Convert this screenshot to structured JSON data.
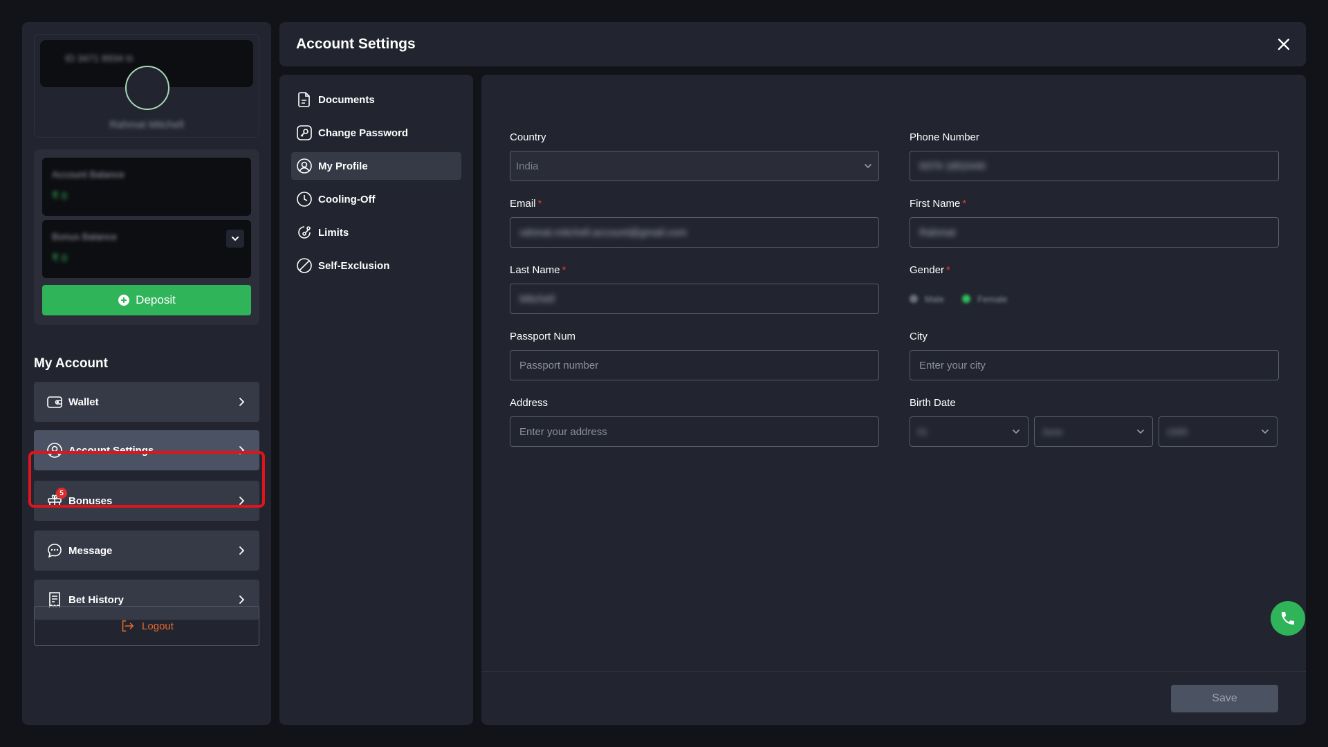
{
  "profile": {
    "user_id": "ID 3471 8934 ⧉",
    "name": "Rahmat Mitchell"
  },
  "balances": {
    "account_label": "Account Balance",
    "account_value": "₹ 0",
    "bonus_label": "Bonus Balance",
    "bonus_value": "₹ 0"
  },
  "deposit_label": "Deposit",
  "sidebar": {
    "heading": "My Account",
    "items": [
      {
        "label": "Wallet"
      },
      {
        "label": "Account Settings"
      },
      {
        "label": "Bonuses",
        "badge": "5"
      },
      {
        "label": "Message"
      },
      {
        "label": "Bet History"
      }
    ],
    "logout_label": "Logout"
  },
  "header": {
    "title": "Account Settings"
  },
  "settings_nav": [
    {
      "label": "Documents"
    },
    {
      "label": "Change Password"
    },
    {
      "label": "My Profile"
    },
    {
      "label": "Cooling-Off"
    },
    {
      "label": "Limits"
    },
    {
      "label": "Self-Exclusion"
    }
  ],
  "form": {
    "country": {
      "label": "Country",
      "value": "India"
    },
    "phone": {
      "label": "Phone Number",
      "value": "9379 1852440"
    },
    "email": {
      "label": "Email",
      "value": "rahmat.mitchell.account@gmail.com"
    },
    "first_name": {
      "label": "First Name",
      "value": "Rahmat"
    },
    "last_name": {
      "label": "Last Name",
      "value": "Mitchell"
    },
    "gender": {
      "label": "Gender",
      "options": [
        "Male",
        "Female"
      ],
      "selected": "Female"
    },
    "passport": {
      "label": "Passport Num",
      "placeholder": "Passport number"
    },
    "city": {
      "label": "City",
      "placeholder": "Enter your city"
    },
    "address": {
      "label": "Address",
      "placeholder": "Enter your address"
    },
    "birth_date": {
      "label": "Birth Date",
      "day": "01",
      "month": "June",
      "year": "1995"
    },
    "required_mark": "*",
    "save_label": "Save"
  },
  "colors": {
    "accent_green": "#2fb45a",
    "logout_orange": "#e4692f",
    "highlight_red": "#e0141b",
    "badge_red": "#e02b2b"
  }
}
